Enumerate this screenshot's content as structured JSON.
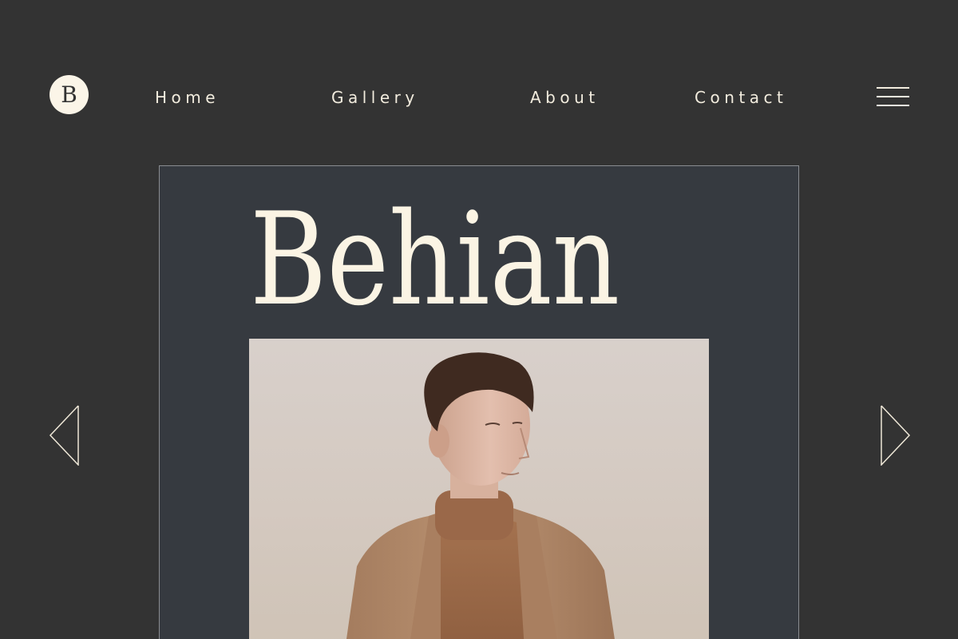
{
  "logo": {
    "letter": "B"
  },
  "nav": {
    "items": [
      "Home",
      "Gallery",
      "About",
      "Contact"
    ]
  },
  "hero": {
    "title": "Behian",
    "photo_alt": "Man in camel coat and turtleneck"
  },
  "colors": {
    "background": "#333333",
    "card": "#363a40",
    "cream": "#fbf4e4",
    "coat": "#b48a67",
    "sweater": "#9b6b4b"
  },
  "icons": {
    "menu": "hamburger-menu-icon",
    "prev": "arrow-left-icon",
    "next": "arrow-right-icon"
  }
}
